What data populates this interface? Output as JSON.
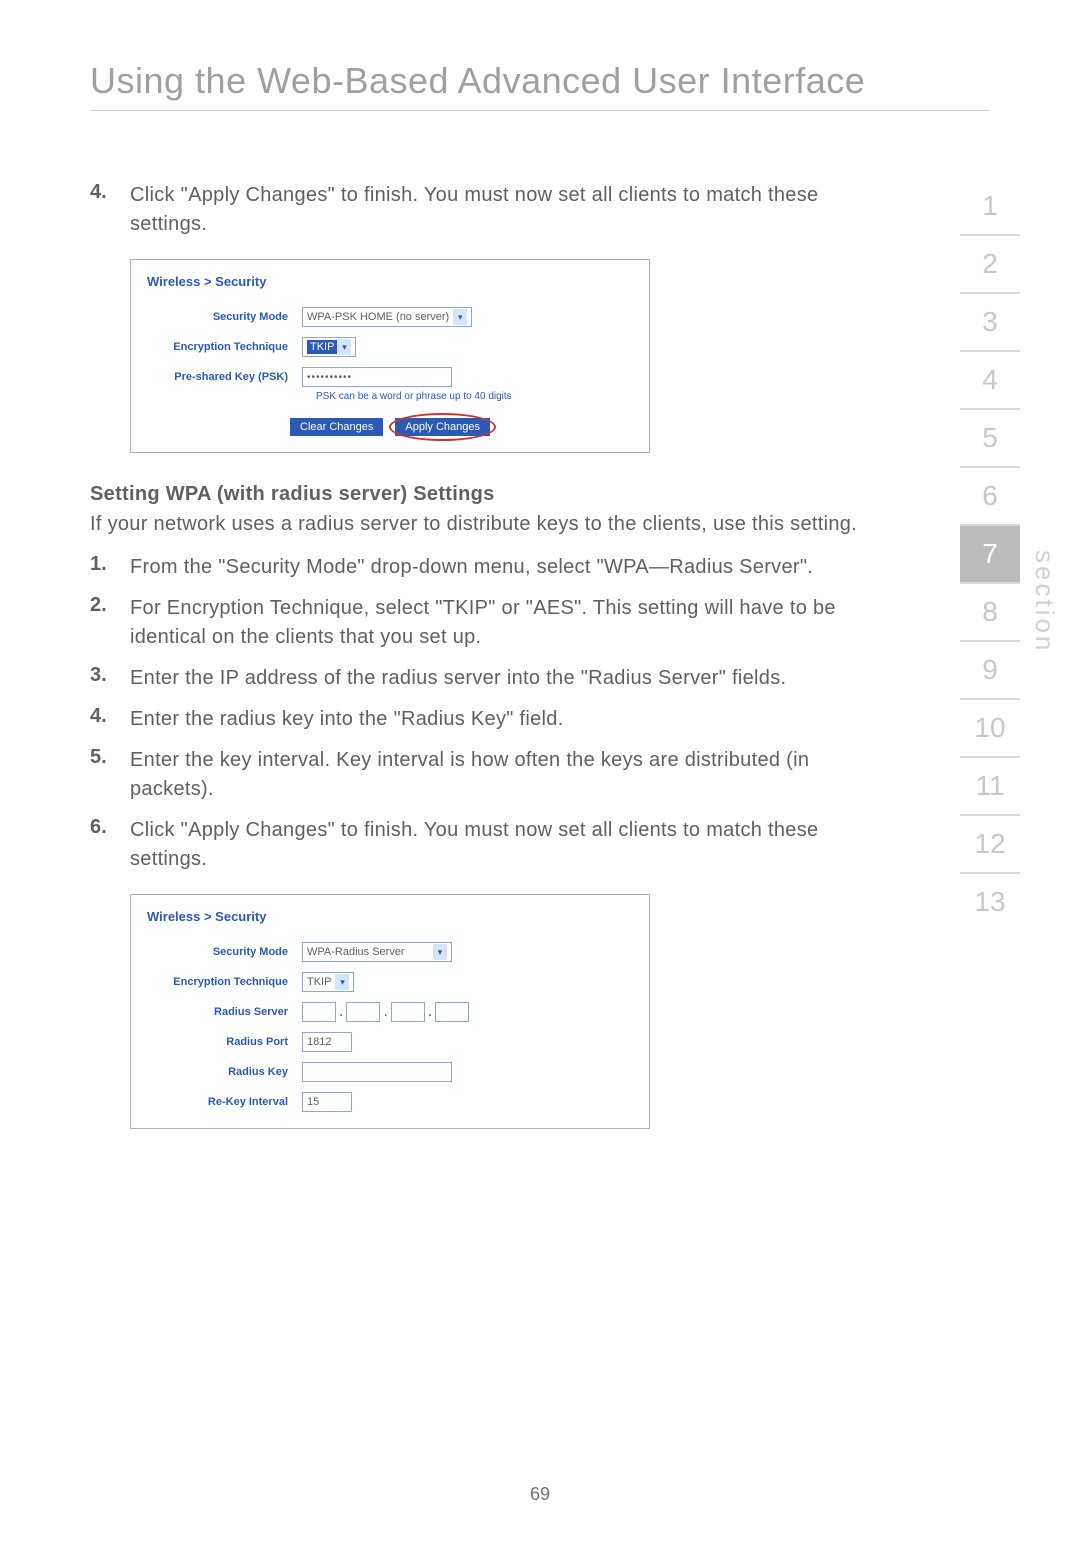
{
  "title": "Using the Web-Based Advanced User Interface",
  "top_list": {
    "num": "4.",
    "text": "Click \"Apply Changes\" to finish. You must now set all clients to match these settings."
  },
  "shot1": {
    "breadcrumb": "Wireless > Security",
    "rows": {
      "mode_label": "Security Mode",
      "mode_value": "WPA-PSK HOME (no server)",
      "enc_label": "Encryption Technique",
      "enc_value": "TKIP",
      "psk_label": "Pre-shared Key (PSK)",
      "psk_value": "••••••••••",
      "psk_hint": "PSK can be a word or phrase up to 40 digits"
    },
    "buttons": {
      "clear": "Clear Changes",
      "apply": "Apply Changes"
    }
  },
  "subhead": "Setting WPA (with radius server) Settings",
  "subpara": "If your network uses a radius server to distribute keys to the clients, use this setting.",
  "steps": [
    {
      "n": "1.",
      "t": "From the \"Security Mode\" drop-down menu, select \"WPA—Radius Server\"."
    },
    {
      "n": "2.",
      "t": "For Encryption Technique, select \"TKIP\" or \"AES\". This setting will have to be identical on the clients that you set up."
    },
    {
      "n": "3.",
      "t": "Enter the IP address of the radius server into the \"Radius Server\" fields."
    },
    {
      "n": "4.",
      "t": "Enter the radius key into the \"Radius Key\" field."
    },
    {
      "n": "5.",
      "t": "Enter the key interval. Key interval is how often the keys are distributed (in packets)."
    },
    {
      "n": "6.",
      "t": "Click \"Apply Changes\" to finish. You must now set all clients to match these settings."
    }
  ],
  "shot2": {
    "breadcrumb": "Wireless > Security",
    "rows": {
      "mode_label": "Security Mode",
      "mode_value": "WPA-Radius Server",
      "enc_label": "Encryption Technique",
      "enc_value": "TKIP",
      "server_label": "Radius Server",
      "port_label": "Radius Port",
      "port_value": "1812",
      "key_label": "Radius Key",
      "interval_label": "Re-Key Interval",
      "interval_value": "15"
    }
  },
  "sidenav": {
    "items": [
      "1",
      "2",
      "3",
      "4",
      "5",
      "6",
      "7",
      "8",
      "9",
      "10",
      "11",
      "12",
      "13"
    ],
    "active_index": 6,
    "label": "section"
  },
  "page_number": "69"
}
